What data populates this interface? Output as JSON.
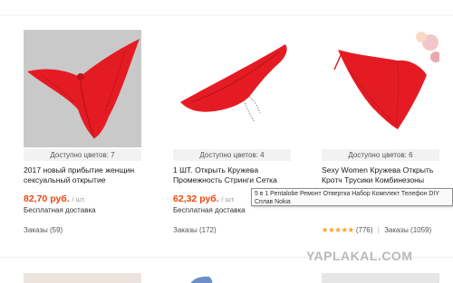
{
  "products": [
    {
      "colors": "Доступно цветов: 7",
      "title": "2017 новый прибытие женщин сексуальный открытие",
      "price": "82,70 руб.",
      "unit": "/ шт.",
      "shipping": "Бесплатная доставка",
      "orders": "Заказы (59)"
    },
    {
      "colors": "Доступно цветов: 4",
      "title": "1 ШТ. Открыть Кружева Промежность Стринги Сетка",
      "price": "62,32 руб.",
      "unit": "/ шт.",
      "shipping": "Бесплатная доставка",
      "orders": "Заказы (172)"
    },
    {
      "colors": "Доступно цветов: 6",
      "title": "Sexy Women Кружева Открыть Кротч Трусики Комбинезоны",
      "stars": "★★★★★",
      "rating_count": "(776)",
      "orders": "Заказы (1059)"
    }
  ],
  "tooltip": "5 в 1 Pentalobe Ремонт Отвертка Набор Комплект Телефон DIY Сплав Nokia",
  "watermark": "YAPLAKAL.COM",
  "colors": {
    "price": "#f2460b",
    "star": "#f5a623",
    "product_red": "#e51b23"
  }
}
